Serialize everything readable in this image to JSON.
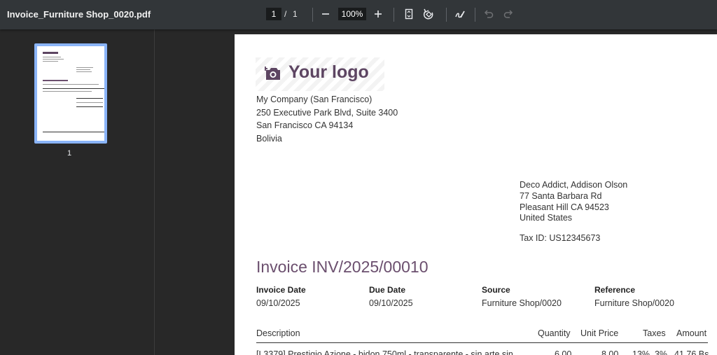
{
  "toolbar": {
    "file_name": "Invoice_Furniture Shop_0020.pdf",
    "current_page": "1",
    "page_separator": "/",
    "total_pages": "1",
    "zoom": "100%"
  },
  "sidebar": {
    "thumbnail_label": "1"
  },
  "document": {
    "logo_text": "Your logo",
    "company": {
      "name": "My Company (San Francisco)",
      "street": "250 Executive Park Blvd, Suite 3400",
      "city": "San Francisco CA 94134",
      "country": "Bolivia"
    },
    "customer": {
      "name": "Deco Addict, Addison Olson",
      "street": "77 Santa Barbara Rd",
      "city": "Pleasant Hill CA 94523",
      "country": "United States",
      "tax_id": "Tax ID: US12345673"
    },
    "title": "Invoice INV/2025/00010",
    "info": [
      {
        "label": "Invoice Date",
        "value": "09/10/2025"
      },
      {
        "label": "Due Date",
        "value": "09/10/2025"
      },
      {
        "label": "Source",
        "value": "Furniture Shop/0020"
      },
      {
        "label": "Reference",
        "value": "Furniture Shop/0020"
      }
    ],
    "table": {
      "headers": [
        "Description",
        "Quantity",
        "Unit Price",
        "Taxes",
        "Amount"
      ],
      "rows": [
        [
          "[L3379] Prestigio Azione - bidon 750ml - transparente - sin arte sin",
          "6.00",
          "8.00",
          "13%, 3%",
          "41.76 Bs"
        ]
      ]
    }
  }
}
